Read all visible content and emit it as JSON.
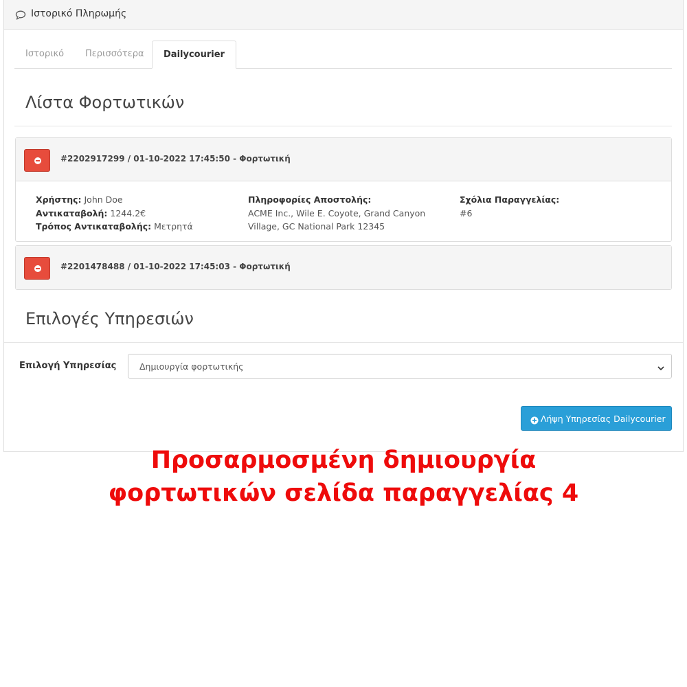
{
  "panel": {
    "title": "Ιστορικό Πληρωμής",
    "icon": "comment-icon"
  },
  "tabs": [
    {
      "label": "Ιστορικό",
      "active": false
    },
    {
      "label": "Περισσότερα",
      "active": false
    },
    {
      "label": "Dailycourier",
      "active": true
    }
  ],
  "shipments_section": {
    "title": "Λίστα Φορτωτικών",
    "items": [
      {
        "title": "#2202917299 / 01-10-2022 17:45:50 - Φορτωτική",
        "expanded": true,
        "user_label": "Χρήστης:",
        "user_value": "John Doe",
        "cod_label": "Αντικαταβολή:",
        "cod_value": "1244.2€",
        "cod_method_label": "Τρόπος Αντικαταβολής:",
        "cod_method_value": "Μετρητά",
        "shipping_label": "Πληροφορίες Αποστολής:",
        "shipping_line1": "ACME Inc., Wile E. Coyote, Grand Canyon",
        "shipping_line2": "Village, GC National Park 12345",
        "comments_label": "Σχόλια Παραγγελίας:",
        "comments_value": "#6"
      },
      {
        "title": "#2201478488 / 01-10-2022 17:45:03 - Φορτωτική",
        "expanded": false
      }
    ]
  },
  "services_section": {
    "title": "Επιλογές Υπηρεσιών",
    "service_label": "Επιλογή Υπηρεσίας",
    "service_selected": "Δημιουργία φορτωτικής",
    "submit_label": "Λήψη Υπηρεσίας Dailycourier"
  },
  "caption": {
    "line1": "Προσαρμοσμένη δημιουργία",
    "line2": "φορτωτικών σελίδα παραγγελίας 4"
  },
  "colors": {
    "danger": "#e74c3c",
    "primary": "#2a9fd8",
    "caption": "#ee0b0b"
  }
}
